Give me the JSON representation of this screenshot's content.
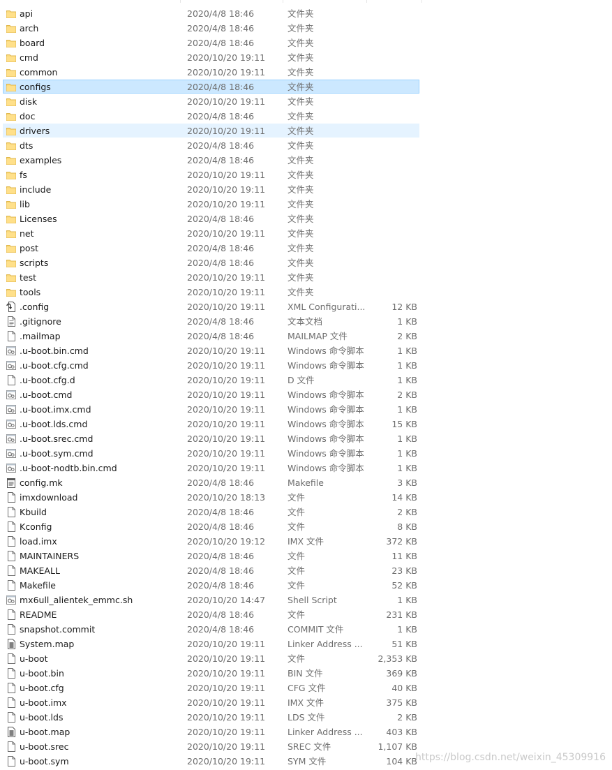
{
  "files": [
    {
      "name": "api",
      "date": "2020/4/8 18:46",
      "type": "文件夹",
      "size": "",
      "icon": "folder"
    },
    {
      "name": "arch",
      "date": "2020/4/8 18:46",
      "type": "文件夹",
      "size": "",
      "icon": "folder"
    },
    {
      "name": "board",
      "date": "2020/4/8 18:46",
      "type": "文件夹",
      "size": "",
      "icon": "folder"
    },
    {
      "name": "cmd",
      "date": "2020/10/20 19:11",
      "type": "文件夹",
      "size": "",
      "icon": "folder"
    },
    {
      "name": "common",
      "date": "2020/10/20 19:11",
      "type": "文件夹",
      "size": "",
      "icon": "folder"
    },
    {
      "name": "configs",
      "date": "2020/4/8 18:46",
      "type": "文件夹",
      "size": "",
      "icon": "folder",
      "state": "selected"
    },
    {
      "name": "disk",
      "date": "2020/10/20 19:11",
      "type": "文件夹",
      "size": "",
      "icon": "folder"
    },
    {
      "name": "doc",
      "date": "2020/4/8 18:46",
      "type": "文件夹",
      "size": "",
      "icon": "folder"
    },
    {
      "name": "drivers",
      "date": "2020/10/20 19:11",
      "type": "文件夹",
      "size": "",
      "icon": "folder",
      "state": "hover"
    },
    {
      "name": "dts",
      "date": "2020/4/8 18:46",
      "type": "文件夹",
      "size": "",
      "icon": "folder"
    },
    {
      "name": "examples",
      "date": "2020/4/8 18:46",
      "type": "文件夹",
      "size": "",
      "icon": "folder"
    },
    {
      "name": "fs",
      "date": "2020/10/20 19:11",
      "type": "文件夹",
      "size": "",
      "icon": "folder"
    },
    {
      "name": "include",
      "date": "2020/10/20 19:11",
      "type": "文件夹",
      "size": "",
      "icon": "folder"
    },
    {
      "name": "lib",
      "date": "2020/10/20 19:11",
      "type": "文件夹",
      "size": "",
      "icon": "folder"
    },
    {
      "name": "Licenses",
      "date": "2020/4/8 18:46",
      "type": "文件夹",
      "size": "",
      "icon": "folder"
    },
    {
      "name": "net",
      "date": "2020/10/20 19:11",
      "type": "文件夹",
      "size": "",
      "icon": "folder"
    },
    {
      "name": "post",
      "date": "2020/4/8 18:46",
      "type": "文件夹",
      "size": "",
      "icon": "folder"
    },
    {
      "name": "scripts",
      "date": "2020/4/8 18:46",
      "type": "文件夹",
      "size": "",
      "icon": "folder"
    },
    {
      "name": "test",
      "date": "2020/10/20 19:11",
      "type": "文件夹",
      "size": "",
      "icon": "folder"
    },
    {
      "name": "tools",
      "date": "2020/10/20 19:11",
      "type": "文件夹",
      "size": "",
      "icon": "folder"
    },
    {
      "name": ".config",
      "date": "2020/10/20 19:11",
      "type": "XML Configurati...",
      "size": "12 KB",
      "icon": "xml"
    },
    {
      "name": ".gitignore",
      "date": "2020/4/8 18:46",
      "type": "文本文档",
      "size": "1 KB",
      "icon": "text"
    },
    {
      "name": ".mailmap",
      "date": "2020/4/8 18:46",
      "type": "MAILMAP 文件",
      "size": "2 KB",
      "icon": "file"
    },
    {
      "name": ".u-boot.bin.cmd",
      "date": "2020/10/20 19:11",
      "type": "Windows 命令脚本",
      "size": "1 KB",
      "icon": "script"
    },
    {
      "name": ".u-boot.cfg.cmd",
      "date": "2020/10/20 19:11",
      "type": "Windows 命令脚本",
      "size": "1 KB",
      "icon": "script"
    },
    {
      "name": ".u-boot.cfg.d",
      "date": "2020/10/20 19:11",
      "type": "D 文件",
      "size": "1 KB",
      "icon": "file"
    },
    {
      "name": ".u-boot.cmd",
      "date": "2020/10/20 19:11",
      "type": "Windows 命令脚本",
      "size": "2 KB",
      "icon": "script"
    },
    {
      "name": ".u-boot.imx.cmd",
      "date": "2020/10/20 19:11",
      "type": "Windows 命令脚本",
      "size": "1 KB",
      "icon": "script"
    },
    {
      "name": ".u-boot.lds.cmd",
      "date": "2020/10/20 19:11",
      "type": "Windows 命令脚本",
      "size": "15 KB",
      "icon": "script"
    },
    {
      "name": ".u-boot.srec.cmd",
      "date": "2020/10/20 19:11",
      "type": "Windows 命令脚本",
      "size": "1 KB",
      "icon": "script"
    },
    {
      "name": ".u-boot.sym.cmd",
      "date": "2020/10/20 19:11",
      "type": "Windows 命令脚本",
      "size": "1 KB",
      "icon": "script"
    },
    {
      "name": ".u-boot-nodtb.bin.cmd",
      "date": "2020/10/20 19:11",
      "type": "Windows 命令脚本",
      "size": "1 KB",
      "icon": "script"
    },
    {
      "name": "config.mk",
      "date": "2020/4/8 18:46",
      "type": "Makefile",
      "size": "3 KB",
      "icon": "makefile"
    },
    {
      "name": "imxdownload",
      "date": "2020/10/20 18:13",
      "type": "文件",
      "size": "14 KB",
      "icon": "file"
    },
    {
      "name": "Kbuild",
      "date": "2020/4/8 18:46",
      "type": "文件",
      "size": "2 KB",
      "icon": "file"
    },
    {
      "name": "Kconfig",
      "date": "2020/4/8 18:46",
      "type": "文件",
      "size": "8 KB",
      "icon": "file"
    },
    {
      "name": "load.imx",
      "date": "2020/10/20 19:12",
      "type": "IMX 文件",
      "size": "372 KB",
      "icon": "file"
    },
    {
      "name": "MAINTAINERS",
      "date": "2020/4/8 18:46",
      "type": "文件",
      "size": "11 KB",
      "icon": "file"
    },
    {
      "name": "MAKEALL",
      "date": "2020/4/8 18:46",
      "type": "文件",
      "size": "23 KB",
      "icon": "file"
    },
    {
      "name": "Makefile",
      "date": "2020/4/8 18:46",
      "type": "文件",
      "size": "52 KB",
      "icon": "file"
    },
    {
      "name": "mx6ull_alientek_emmc.sh",
      "date": "2020/10/20 14:47",
      "type": "Shell Script",
      "size": "1 KB",
      "icon": "script"
    },
    {
      "name": "README",
      "date": "2020/4/8 18:46",
      "type": "文件",
      "size": "231 KB",
      "icon": "file"
    },
    {
      "name": "snapshot.commit",
      "date": "2020/4/8 18:46",
      "type": "COMMIT 文件",
      "size": "1 KB",
      "icon": "file"
    },
    {
      "name": "System.map",
      "date": "2020/10/20 19:11",
      "type": "Linker Address ...",
      "size": "51 KB",
      "icon": "map"
    },
    {
      "name": "u-boot",
      "date": "2020/10/20 19:11",
      "type": "文件",
      "size": "2,353 KB",
      "icon": "file"
    },
    {
      "name": "u-boot.bin",
      "date": "2020/10/20 19:11",
      "type": "BIN 文件",
      "size": "369 KB",
      "icon": "file"
    },
    {
      "name": "u-boot.cfg",
      "date": "2020/10/20 19:11",
      "type": "CFG 文件",
      "size": "40 KB",
      "icon": "file"
    },
    {
      "name": "u-boot.imx",
      "date": "2020/10/20 19:11",
      "type": "IMX 文件",
      "size": "375 KB",
      "icon": "file"
    },
    {
      "name": "u-boot.lds",
      "date": "2020/10/20 19:11",
      "type": "LDS 文件",
      "size": "2 KB",
      "icon": "file"
    },
    {
      "name": "u-boot.map",
      "date": "2020/10/20 19:11",
      "type": "Linker Address ...",
      "size": "403 KB",
      "icon": "map"
    },
    {
      "name": "u-boot.srec",
      "date": "2020/10/20 19:11",
      "type": "SREC 文件",
      "size": "1,107 KB",
      "icon": "file"
    },
    {
      "name": "u-boot.sym",
      "date": "2020/10/20 19:11",
      "type": "SYM 文件",
      "size": "104 KB",
      "icon": "file"
    }
  ],
  "watermark": "https://blog.csdn.net/weixin_45309916"
}
